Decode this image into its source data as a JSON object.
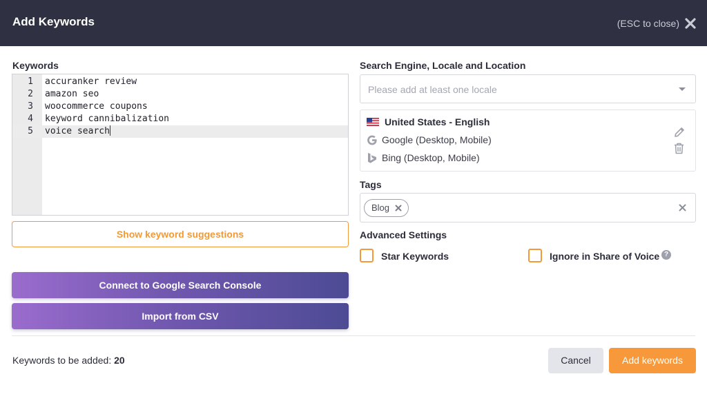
{
  "dialog": {
    "title": "Add Keywords",
    "esc_hint": "(ESC to close)"
  },
  "keywords": {
    "label": "Keywords",
    "lines": [
      {
        "number": "1",
        "text": "accuranker review"
      },
      {
        "number": "2",
        "text": "amazon seo"
      },
      {
        "number": "3",
        "text": "woocommerce coupons"
      },
      {
        "number": "4",
        "text": "keyword cannibalization"
      },
      {
        "number": "5",
        "text": "voice search"
      }
    ],
    "suggestions_button": "Show keyword suggestions",
    "connect_button": "Connect to Google Search Console",
    "import_button": "Import from CSV"
  },
  "locale": {
    "label": "Search Engine, Locale and Location",
    "placeholder": "Please add at least one locale",
    "selected": {
      "name": "United States - English",
      "flag_icon": "us-flag-icon",
      "engines": [
        {
          "icon": "google-icon",
          "text": "Google (Desktop, Mobile)"
        },
        {
          "icon": "bing-icon",
          "text": "Bing (Desktop, Mobile)"
        }
      ]
    }
  },
  "tags": {
    "label": "Tags",
    "items": [
      "Blog"
    ]
  },
  "advanced": {
    "label": "Advanced Settings",
    "star_keywords": {
      "label": "Star Keywords",
      "checked": false
    },
    "ignore_sov": {
      "label": "Ignore in Share of Voice",
      "checked": false
    }
  },
  "footer": {
    "count_label": "Keywords to be added:",
    "count_value": "20",
    "cancel": "Cancel",
    "add": "Add keywords"
  },
  "colors": {
    "header_bg": "#2f3142",
    "accent_orange": "#f7993b",
    "gradient_start": "#9a6ccd",
    "gradient_end": "#4d4b94"
  }
}
